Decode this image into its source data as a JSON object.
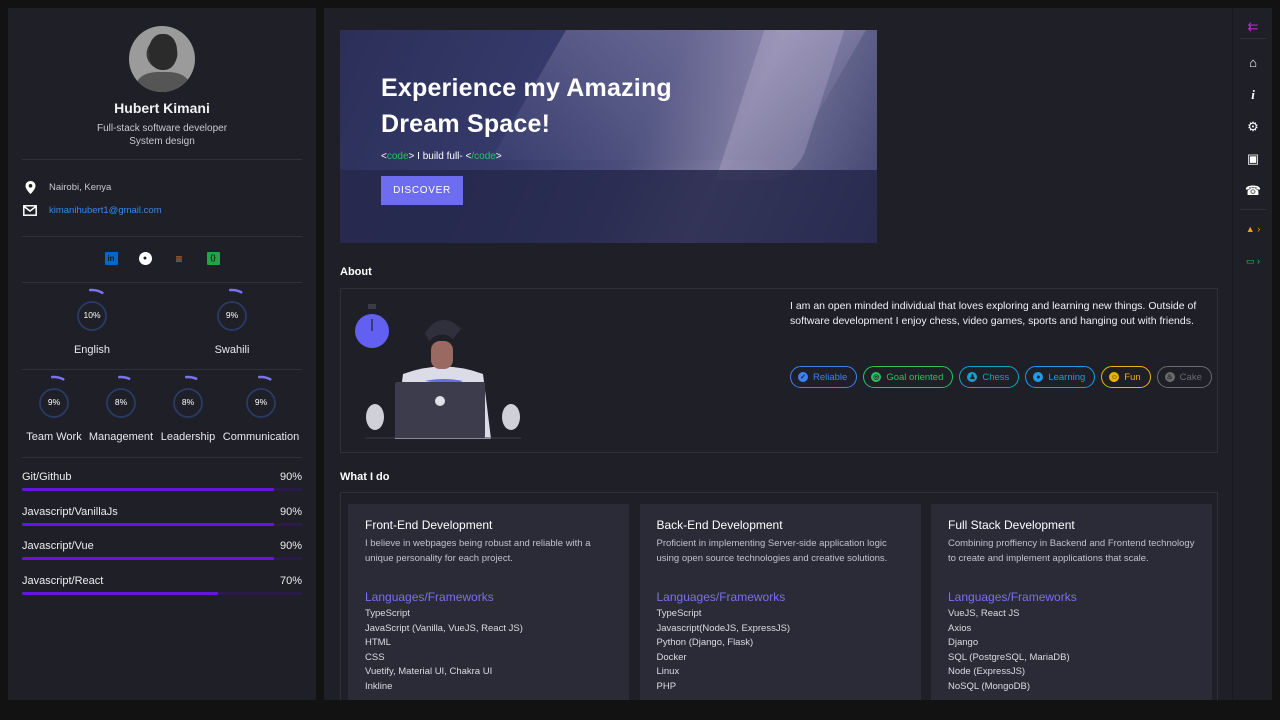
{
  "profile": {
    "name": "Hubert Kimani",
    "subtitle_line1": "Full-stack software developer",
    "subtitle_line2": "System design",
    "location": "Nairobi, Kenya",
    "email": "kimanihubert1@gmail.com",
    "socials": [
      {
        "name": "linkedin",
        "glyph": "in",
        "color": "#0a66c2"
      },
      {
        "name": "github",
        "glyph": "●",
        "color": "#ffffff"
      },
      {
        "name": "stackoverflow",
        "glyph": "≡",
        "color": "#f48024"
      },
      {
        "name": "codepen",
        "glyph": "{}",
        "color": "#22a447"
      }
    ]
  },
  "languages": [
    {
      "label": "English",
      "percent": "10%",
      "value": 10
    },
    {
      "label": "Swahili",
      "percent": "9%",
      "value": 9
    }
  ],
  "soft_skills": [
    {
      "label": "Team Work",
      "percent": "9%",
      "value": 9
    },
    {
      "label": "Management",
      "percent": "8%",
      "value": 8
    },
    {
      "label": "Leadership",
      "percent": "8%",
      "value": 8
    },
    {
      "label": "Communication",
      "percent": "9%",
      "value": 9
    }
  ],
  "tech_skills": [
    {
      "label": "Git/Github",
      "percent": "90%",
      "value": 90
    },
    {
      "label": "Javascript/VanillaJs",
      "percent": "90%",
      "value": 90
    },
    {
      "label": "Javascript/Vue",
      "percent": "90%",
      "value": 90
    },
    {
      "label": "Javascript/React",
      "percent": "70%",
      "value": 70
    }
  ],
  "hero": {
    "title_line1": "Experience my Amazing",
    "title_line2": "Dream Space!",
    "code_open_lt": "<",
    "code_open_tag": "code",
    "code_open_gt": ">",
    "typed_text": " I build full- ",
    "code_close_lt": "<",
    "code_close_tag": "/code",
    "code_close_gt": ">",
    "button_label": "DISCOVER"
  },
  "about": {
    "title": "About",
    "text": "I am an open minded individual that loves exploring and learning new things. Outside of software development I enjoy chess, video games, sports and hanging out with friends.",
    "chips": [
      {
        "label": "Reliable",
        "icon": "verified-icon",
        "glyph": "✓",
        "color": "#3b82f6"
      },
      {
        "label": "Goal oriented",
        "icon": "target-icon",
        "glyph": "◎",
        "color": "#22c55e"
      },
      {
        "label": "Chess",
        "icon": "chess-icon",
        "glyph": "♟",
        "color": "#0ea5c6"
      },
      {
        "label": "Learning",
        "icon": "lightbulb-icon",
        "glyph": "●",
        "color": "#1d9bf0"
      },
      {
        "label": "Fun",
        "icon": "smile-icon",
        "glyph": "☺",
        "color": "#eab308"
      },
      {
        "label": "Cake",
        "icon": "cake-icon",
        "glyph": "♨",
        "color": "#6b6b6b"
      }
    ]
  },
  "what_i_do": {
    "title": "What I do",
    "cards": [
      {
        "title": "Front-End Development",
        "description": "I believe in webpages being robust and reliable with a unique personality for each project.",
        "list_title": "Languages/Frameworks",
        "items": [
          "TypeScript",
          "JavaScript (Vanilla, VueJS, React JS)",
          "HTML",
          "CSS",
          "Vuetify, Material UI, Chakra UI",
          "Inkline"
        ]
      },
      {
        "title": "Back-End Development",
        "description": "Proficient in implementing Server-side application logic using open source technologies and creative solutions.",
        "list_title": "Languages/Frameworks",
        "items": [
          "TypeScript",
          "Javascript(NodeJS, ExpressJS)",
          "Python (Django, Flask)",
          "Docker",
          "Linux",
          "PHP"
        ]
      },
      {
        "title": "Full Stack Development",
        "description": "Combining proffiency in Backend and Frontend technology to create and implement applications that scale.",
        "list_title": "Languages/Frameworks",
        "items": [
          "VueJS, React JS",
          "Axios",
          "Django",
          "SQL (PostgreSQL, MariaDB)",
          "Node (ExpressJS)",
          "NoSQL (MongoDB)"
        ]
      }
    ]
  },
  "nav_rail": {
    "items": [
      {
        "name": "collapse-menu-icon",
        "glyph": "⇇",
        "color": "#c026d3"
      },
      {
        "name": "home-icon",
        "glyph": "⌂",
        "color": "#ffffff"
      },
      {
        "name": "info-icon",
        "glyph": "i",
        "color": "#ffffff"
      },
      {
        "name": "gear-icon",
        "glyph": "⚙",
        "color": "#ffffff"
      },
      {
        "name": "briefcase-icon",
        "glyph": "▣",
        "color": "#ffffff"
      },
      {
        "name": "phone-icon",
        "glyph": "☎",
        "color": "#ffffff"
      },
      {
        "name": "user-icon",
        "glyph": "▲ ›",
        "color": "#f59e0b"
      },
      {
        "name": "money-icon",
        "glyph": "▭ ›",
        "color": "#22c55e"
      }
    ]
  },
  "colors": {
    "accent": "#6e6cf0",
    "progress": "#6a14e0",
    "background": "#1e1f27",
    "card": "#2a2b37"
  }
}
